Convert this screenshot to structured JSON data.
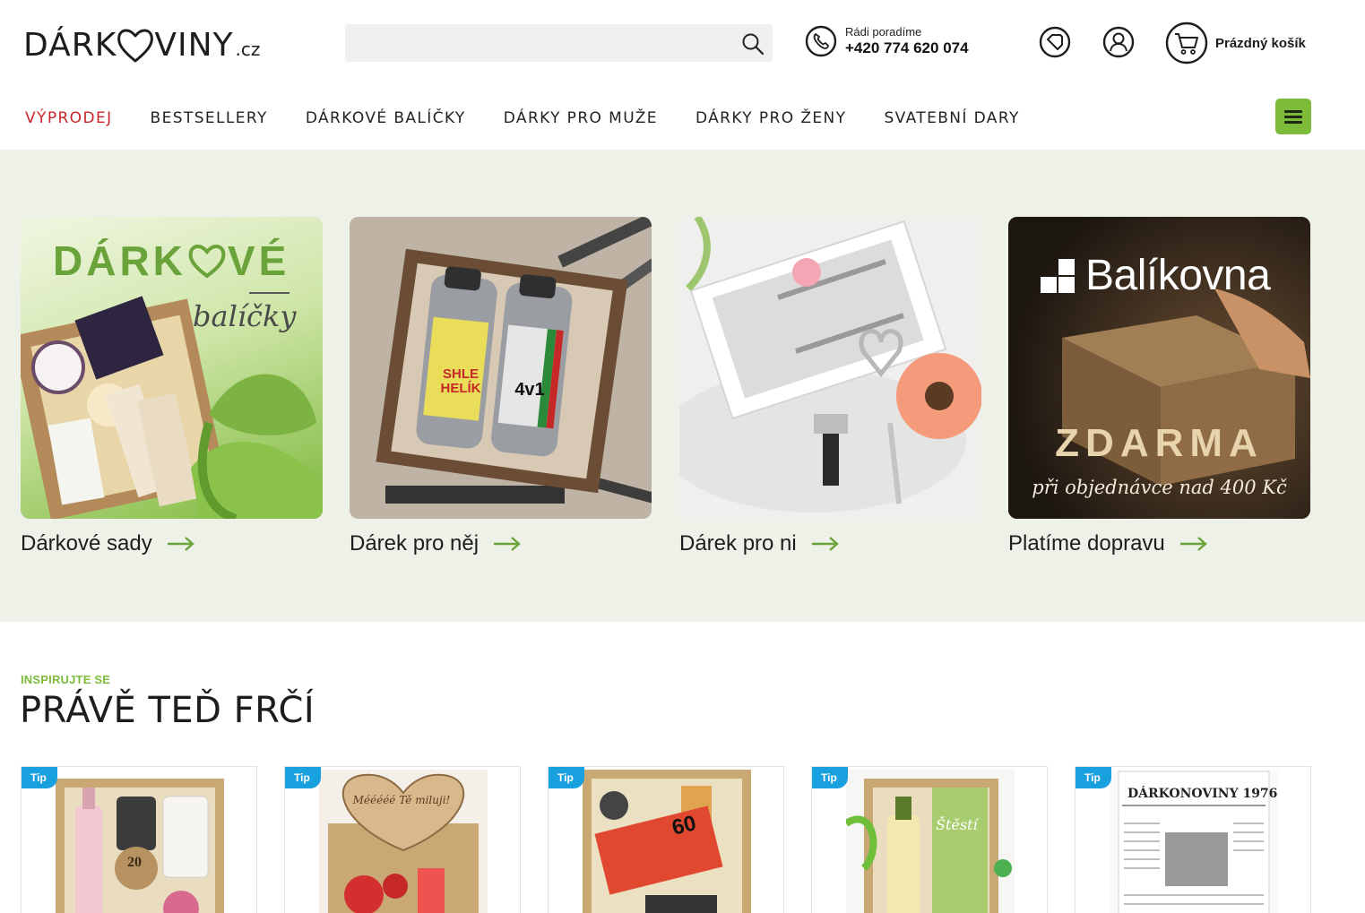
{
  "logo": {
    "text_left": "DÁRK",
    "text_right": "VINY",
    "tld": ".cz"
  },
  "search": {
    "placeholder": "",
    "value": ""
  },
  "contact": {
    "caption": "Rádi poradíme",
    "phone": "+420 774 620 074"
  },
  "cart": {
    "label": "Prázdný košík"
  },
  "icons": {
    "favorites": "heart-tag-icon",
    "account": "user-icon",
    "cart": "cart-icon",
    "search": "search-icon",
    "phone": "phone-icon",
    "menu": "hamburger-icon"
  },
  "nav": {
    "items": [
      {
        "label": "VÝPRODEJ"
      },
      {
        "label": "BESTSELLERY"
      },
      {
        "label": "DÁRKOVÉ BALÍČKY"
      },
      {
        "label": "DÁRKY PRO MUŽE"
      },
      {
        "label": "DÁRKY PRO ŽENY"
      },
      {
        "label": "SVATEBNÍ DARY"
      }
    ]
  },
  "hero": {
    "tiles": [
      {
        "label": "Dárkové sady",
        "art_title_left": "DÁRK",
        "art_title_right": "VÉ",
        "art_sub": "balíčky"
      },
      {
        "label": "Dárek pro něj",
        "art_bottle_1": "SHLE HELÍK",
        "art_bottle_2": "4v1"
      },
      {
        "label": "Dárek pro ni"
      },
      {
        "label": "Platíme dopravu",
        "art_brand": "Balíkovna",
        "art_free": "ZDARMA",
        "art_note": "při objednávce nad 400 Kč"
      }
    ]
  },
  "section": {
    "eyebrow": "INSPIRUJTE SE",
    "title": "PRÁVĚ TEĎ FRČÍ"
  },
  "products": [
    {
      "badge": "Tip",
      "art_text": "20"
    },
    {
      "badge": "Tip",
      "art_text": "Mééééé Tě miluji!"
    },
    {
      "badge": "Tip",
      "art_text": "60"
    },
    {
      "badge": "Tip",
      "art_text": "Štěstí"
    },
    {
      "badge": "Tip",
      "art_text": "DÁRKONOVINY 1976"
    }
  ],
  "colors": {
    "accent_green": "#7dbb3a",
    "sale_red": "#c8262a",
    "hero_bg": "#eef1e8",
    "tip_blue": "#19a0de"
  }
}
